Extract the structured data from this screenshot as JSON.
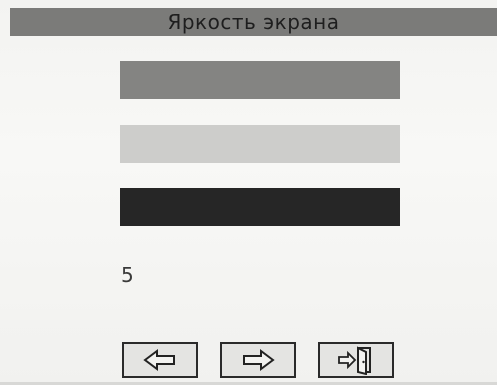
{
  "screen": {
    "title": "Яркость экрана",
    "level_value": "5"
  },
  "preview_bars": [
    {
      "name": "medium-gray",
      "color": "#848482"
    },
    {
      "name": "light-gray",
      "color": "#cdcdcb"
    },
    {
      "name": "dark",
      "color": "#262626"
    }
  ],
  "buttons": {
    "prev_icon": "arrow-left-icon",
    "next_icon": "arrow-right-icon",
    "exit_icon": "exit-door-icon"
  }
}
